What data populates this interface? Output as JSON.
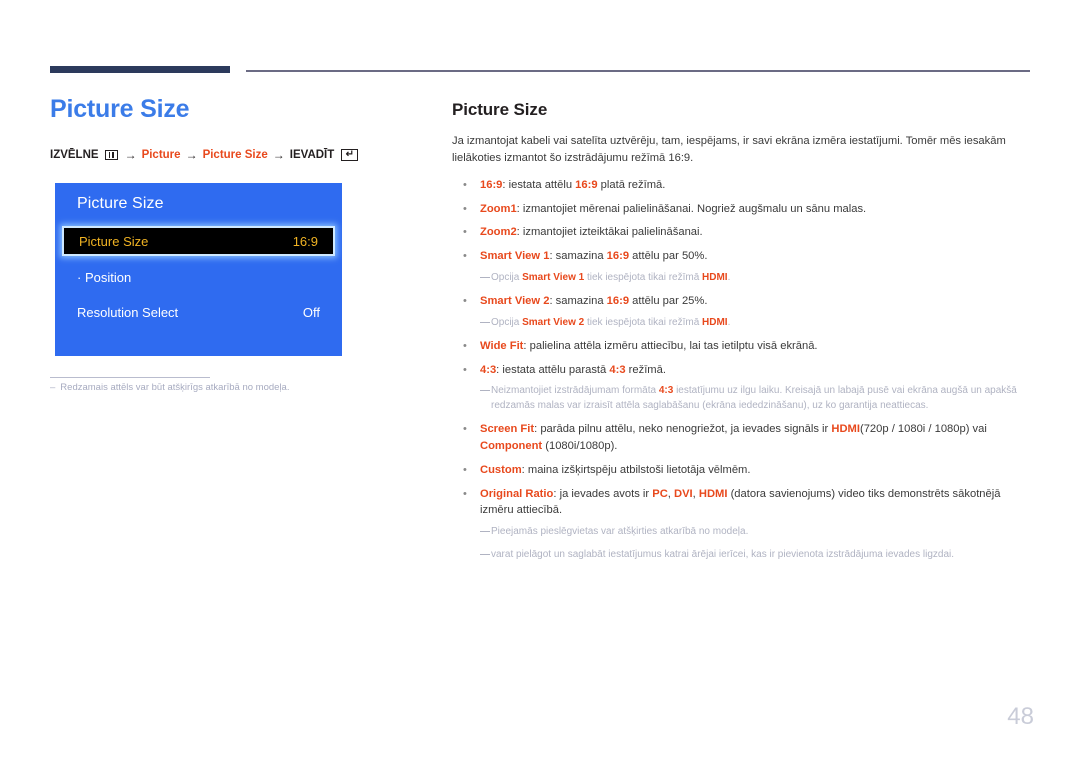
{
  "page": {
    "number": "48"
  },
  "left": {
    "title": "Picture Size",
    "breadcrumb": {
      "label_menu": "IZVĒLNE",
      "menu_icon": "menu-icon",
      "arrow": "→",
      "crumb1": "Picture",
      "crumb2": "Picture Size",
      "label_enter": "IEVADĪT",
      "enter_icon": "enter-key-icon",
      "enter_glyph": "↵"
    },
    "osd": {
      "title": "Picture Size",
      "rows": [
        {
          "label": "Picture Size",
          "value": "16:9",
          "selected": true
        },
        {
          "label": "· Position",
          "value": "",
          "selected": false
        },
        {
          "label": "Resolution Select",
          "value": "Off",
          "selected": false
        }
      ]
    },
    "footnote": {
      "dash": "–",
      "text": "Redzamais attēls var būt atšķirīgs atkarībā no modeļa."
    }
  },
  "right": {
    "title": "Picture Size",
    "intro": "Ja izmantojat kabeli vai satelīta uztvērēju, tam, iespējams, ir savi ekrāna izmēra iestatījumi. Tomēr mēs iesakām lielākoties izmantot šo izstrādājumu režīmā 16:9.",
    "bullet_marker": "•",
    "note_marker": "—",
    "items": [
      {
        "kind": "bullet",
        "term": "16:9",
        "sep": ": ",
        "parts": [
          {
            "t": "iestata attēlu ",
            "style": "plain"
          },
          {
            "t": "16:9",
            "style": "red"
          },
          {
            "t": " platā režīmā.",
            "style": "plain"
          }
        ]
      },
      {
        "kind": "bullet",
        "term": "Zoom1",
        "sep": ": ",
        "parts": [
          {
            "t": "izmantojiet mērenai palielināšanai. Nogriež augšmalu un sānu malas.",
            "style": "plain"
          }
        ]
      },
      {
        "kind": "bullet",
        "term": "Zoom2",
        "sep": ": ",
        "parts": [
          {
            "t": "izmantojiet izteiktākai palielināšanai.",
            "style": "plain"
          }
        ]
      },
      {
        "kind": "bullet",
        "term": "Smart View 1",
        "sep": ": ",
        "parts": [
          {
            "t": "samazina ",
            "style": "plain"
          },
          {
            "t": "16:9",
            "style": "red"
          },
          {
            "t": " attēlu par 50%.",
            "style": "plain"
          }
        ]
      },
      {
        "kind": "note",
        "parts": [
          {
            "t": "Opcija ",
            "style": "plain"
          },
          {
            "t": "Smart View 1",
            "style": "red"
          },
          {
            "t": " tiek iespējota tikai režīmā ",
            "style": "plain"
          },
          {
            "t": "HDMI",
            "style": "red"
          },
          {
            "t": ".",
            "style": "plain"
          }
        ]
      },
      {
        "kind": "bullet",
        "term": "Smart View 2",
        "sep": ": ",
        "parts": [
          {
            "t": "samazina ",
            "style": "plain"
          },
          {
            "t": "16:9",
            "style": "red"
          },
          {
            "t": " attēlu par 25%.",
            "style": "plain"
          }
        ]
      },
      {
        "kind": "note",
        "parts": [
          {
            "t": "Opcija ",
            "style": "plain"
          },
          {
            "t": "Smart View 2",
            "style": "red"
          },
          {
            "t": " tiek iespējota tikai režīmā ",
            "style": "plain"
          },
          {
            "t": "HDMI",
            "style": "red"
          },
          {
            "t": ".",
            "style": "plain"
          }
        ]
      },
      {
        "kind": "bullet",
        "term": "Wide Fit",
        "sep": ": ",
        "parts": [
          {
            "t": "palielina attēla izmēru attiecību, lai tas ietilptu visā ekrānā.",
            "style": "plain"
          }
        ]
      },
      {
        "kind": "bullet",
        "term": "4:3",
        "sep": ": ",
        "parts": [
          {
            "t": "iestata attēlu parastā ",
            "style": "plain"
          },
          {
            "t": "4:3",
            "style": "red"
          },
          {
            "t": " režīmā.",
            "style": "plain"
          }
        ]
      },
      {
        "kind": "note",
        "parts": [
          {
            "t": "Neizmantojiet izstrādājumam formāta ",
            "style": "plain"
          },
          {
            "t": "4:3",
            "style": "red"
          },
          {
            "t": " iestatījumu uz ilgu laiku. Kreisajā un labajā pusē vai ekrāna augšā un apakšā redzamās malas var izraisīt attēla saglabāšanu (ekrāna iededzināšanu), uz ko garantija neattiecas.",
            "style": "plain"
          }
        ]
      },
      {
        "kind": "bullet",
        "term": "Screen Fit",
        "sep": ": ",
        "parts": [
          {
            "t": "parāda pilnu attēlu, neko nenogriežot, ja ievades signāls ir ",
            "style": "plain"
          },
          {
            "t": "HDMI",
            "style": "red"
          },
          {
            "t": "(720p / 1080i / 1080p) vai ",
            "style": "plain"
          },
          {
            "t": "Component",
            "style": "red"
          },
          {
            "t": " (1080i/1080p).",
            "style": "plain"
          }
        ]
      },
      {
        "kind": "bullet",
        "term": "Custom",
        "sep": ": ",
        "parts": [
          {
            "t": "maina izšķirtspēju atbilstoši lietotāja vēlmēm.",
            "style": "plain"
          }
        ]
      },
      {
        "kind": "bullet",
        "term": "Original Ratio",
        "sep": ": ",
        "parts": [
          {
            "t": "ja ievades avots ir ",
            "style": "plain"
          },
          {
            "t": "PC",
            "style": "red"
          },
          {
            "t": ", ",
            "style": "plain"
          },
          {
            "t": "DVI",
            "style": "red"
          },
          {
            "t": ", ",
            "style": "plain"
          },
          {
            "t": "HDMI",
            "style": "red"
          },
          {
            "t": " (datora savienojums) video tiks demonstrēts sākotnējā izmēru attiecībā.",
            "style": "plain"
          }
        ]
      },
      {
        "kind": "note",
        "parts": [
          {
            "t": "Pieejamās pieslēgvietas var atšķirties atkarībā no modeļa.",
            "style": "plain"
          }
        ]
      },
      {
        "kind": "note",
        "loose": true,
        "parts": [
          {
            "t": "varat pielāgot un saglabāt iestatījumus katrai ārējai ierīcei, kas ir pievienota izstrādājuma ievades ligzdai.",
            "style": "plain"
          }
        ]
      }
    ]
  },
  "colors": {
    "accent_blue": "#3b7ce8",
    "osd_blue": "#2f6bf0",
    "accent_red": "#e8491d",
    "rule_navy": "#2c3a5c",
    "note_gray": "#b0b3c2",
    "osd_highlight_text": "#f0b323"
  }
}
